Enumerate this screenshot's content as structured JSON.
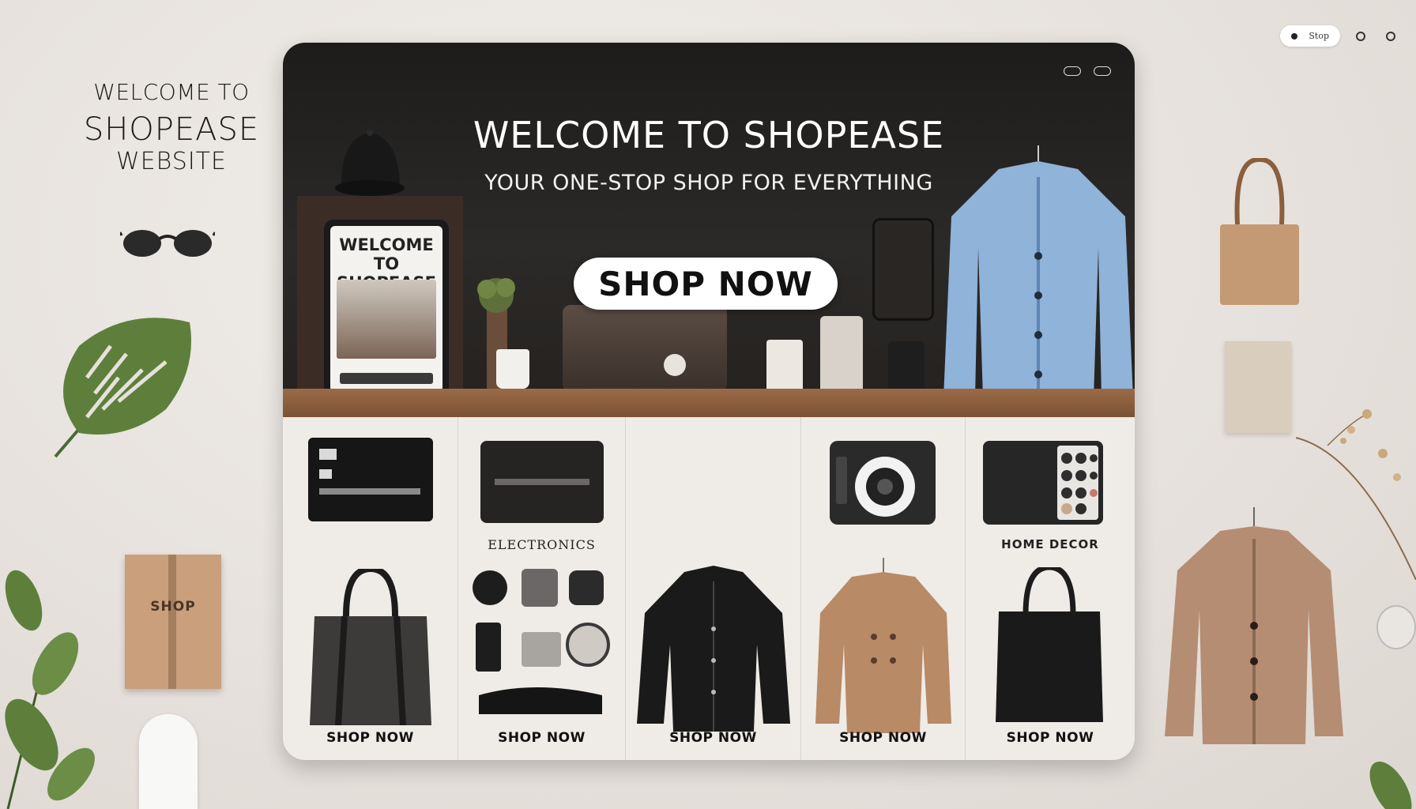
{
  "top_nav": {
    "items": [
      "",
      "",
      "",
      ""
    ]
  },
  "corner_nav": {
    "pill_label": "Stop",
    "link1": "",
    "link2": ""
  },
  "side": {
    "line1": "WELCOME TO",
    "line2": "SHOPEASE",
    "line3": "WEBSITE"
  },
  "hero": {
    "top_label": "",
    "btn1": "",
    "btn2": "",
    "title": "WELCOME TO SHOPEASE",
    "subtitle": "YOUR ONE-STOP SHOP FOR EVERYTHING",
    "tagline": "",
    "cta": "SHOP NOW",
    "tablet_title": "WELCOME TO SHOPEASE"
  },
  "categories": [
    {
      "label": "",
      "cta": "SHOP NOW"
    },
    {
      "label": "ELECTRONICS",
      "cta": "SHOP NOW"
    },
    {
      "label": "",
      "cta": "SHOP NOW"
    },
    {
      "label": "",
      "cta": "SHOP NOW"
    },
    {
      "label": "HOME DECOR",
      "cta": "SHOP NOW"
    }
  ],
  "box_label": "SHOP",
  "colors": {
    "hero_bg": "#1d1c1b",
    "shelf": "#8a5d3e",
    "cardigan_blue": "#8fb3d9",
    "cardigan_tan": "#b58d73"
  }
}
